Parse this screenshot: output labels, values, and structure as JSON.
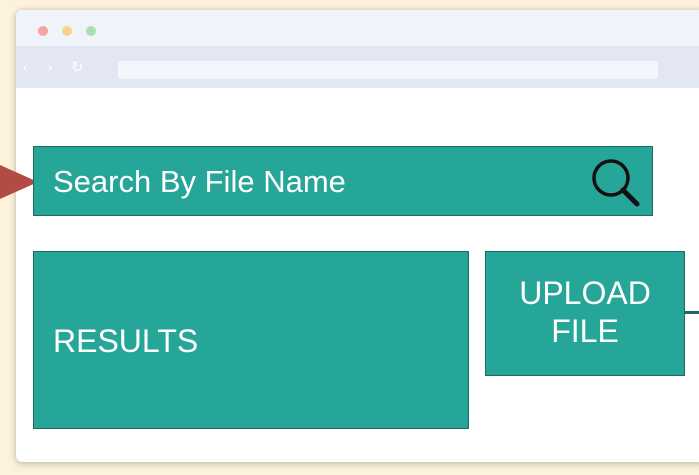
{
  "colors": {
    "accent": "#26a599",
    "accent_border": "#1d6a63",
    "page_background": "#fdf3dc",
    "arrow": "#b24b44"
  },
  "browser": {
    "nav_icons": [
      "back-icon",
      "forward-icon",
      "reload-icon"
    ],
    "url_bar_value": ""
  },
  "search": {
    "placeholder": "Search By File Name",
    "icon": "search-icon"
  },
  "results": {
    "label": "RESULTS"
  },
  "upload": {
    "line1": "UPLOAD",
    "line2": "FILE"
  }
}
